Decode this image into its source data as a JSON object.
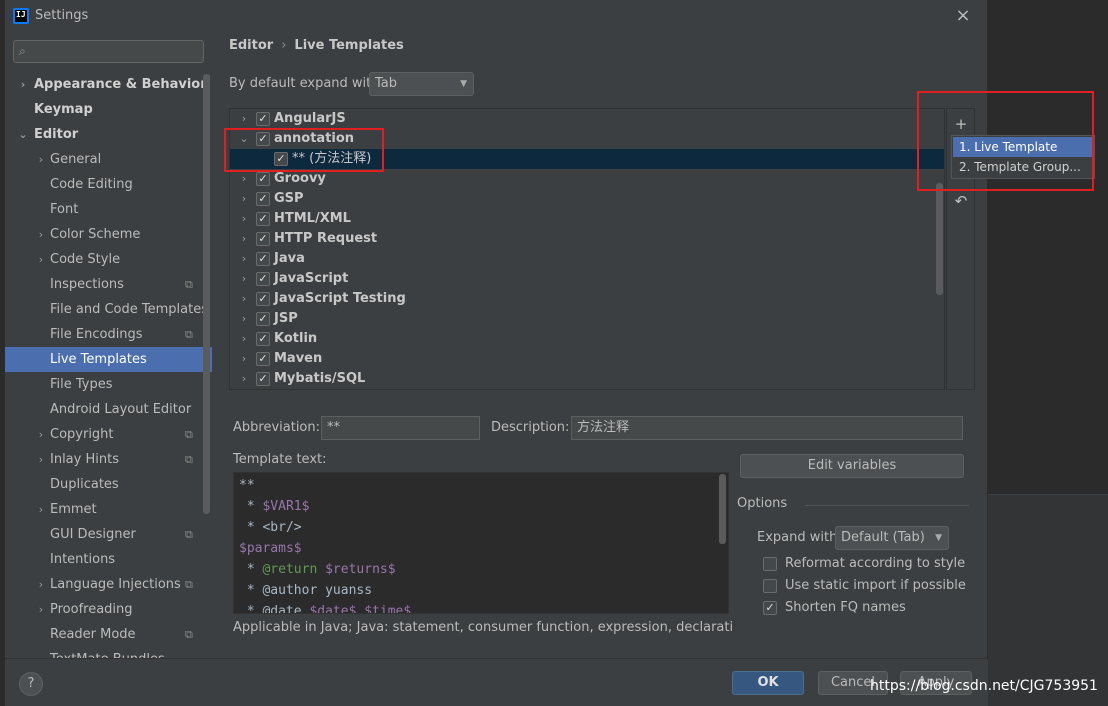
{
  "window": {
    "title": "Settings",
    "close_icon": "×",
    "app_logo_text": "IJ"
  },
  "search": {
    "placeholder": ""
  },
  "sidebar": {
    "items": [
      {
        "label": "Appearance & Behavior",
        "arrow": "›",
        "bold": true
      },
      {
        "label": "Keymap",
        "arrow": "",
        "bold": true
      },
      {
        "label": "Editor",
        "arrow": "⌄",
        "bold": true
      },
      {
        "label": "General",
        "arrow": "›"
      },
      {
        "label": "Code Editing",
        "arrow": ""
      },
      {
        "label": "Font",
        "arrow": ""
      },
      {
        "label": "Color Scheme",
        "arrow": "›"
      },
      {
        "label": "Code Style",
        "arrow": "›"
      },
      {
        "label": "Inspections",
        "arrow": "",
        "copy": true
      },
      {
        "label": "File and Code Templates",
        "arrow": ""
      },
      {
        "label": "File Encodings",
        "arrow": "",
        "copy": true
      },
      {
        "label": "Live Templates",
        "arrow": "",
        "selected": true
      },
      {
        "label": "File Types",
        "arrow": ""
      },
      {
        "label": "Android Layout Editor",
        "arrow": ""
      },
      {
        "label": "Copyright",
        "arrow": "›",
        "copy": true
      },
      {
        "label": "Inlay Hints",
        "arrow": "›",
        "copy": true
      },
      {
        "label": "Duplicates",
        "arrow": ""
      },
      {
        "label": "Emmet",
        "arrow": "›"
      },
      {
        "label": "GUI Designer",
        "arrow": "",
        "copy": true
      },
      {
        "label": "Intentions",
        "arrow": ""
      },
      {
        "label": "Language Injections",
        "arrow": "›",
        "copy": true
      },
      {
        "label": "Proofreading",
        "arrow": "›"
      },
      {
        "label": "Reader Mode",
        "arrow": "",
        "copy": true
      },
      {
        "label": "TextMate Bundles",
        "arrow": ""
      }
    ]
  },
  "breadcrumb": {
    "part1": "Editor",
    "separator": "›",
    "part2": "Live Templates"
  },
  "expand": {
    "label": "By default expand with",
    "value": "Tab"
  },
  "templates": [
    {
      "label": "AngularJS",
      "arrow": "›",
      "checked": true
    },
    {
      "label": "annotation",
      "arrow": "⌄",
      "checked": true
    },
    {
      "label": "** (方法注释)",
      "arrow": "",
      "checked": true,
      "child": true,
      "selected": true
    },
    {
      "label": "Groovy",
      "arrow": "›",
      "checked": true
    },
    {
      "label": "GSP",
      "arrow": "›",
      "checked": true
    },
    {
      "label": "HTML/XML",
      "arrow": "›",
      "checked": true
    },
    {
      "label": "HTTP Request",
      "arrow": "›",
      "checked": true
    },
    {
      "label": "Java",
      "arrow": "›",
      "checked": true
    },
    {
      "label": "JavaScript",
      "arrow": "›",
      "checked": true
    },
    {
      "label": "JavaScript Testing",
      "arrow": "›",
      "checked": true
    },
    {
      "label": "JSP",
      "arrow": "›",
      "checked": true
    },
    {
      "label": "Kotlin",
      "arrow": "›",
      "checked": true
    },
    {
      "label": "Maven",
      "arrow": "›",
      "checked": true
    },
    {
      "label": "Mybatis/SQL",
      "arrow": "›",
      "checked": true
    }
  ],
  "tools": {
    "add": "+",
    "remove": "−",
    "undo": "↶"
  },
  "popup": {
    "item1": "1. Live Template",
    "item2": "2. Template Group..."
  },
  "abbreviation": {
    "label": "Abbreviation:",
    "value": "**"
  },
  "description": {
    "label": "Description:",
    "value": "方法注释"
  },
  "template_text": {
    "label": "Template text:",
    "lines": [
      [
        {
          "t": "**",
          "c": ""
        }
      ],
      [
        {
          "t": " * ",
          "c": ""
        },
        {
          "t": "$VAR1$",
          "c": "var"
        }
      ],
      [
        {
          "t": " * <br/>",
          "c": ""
        }
      ],
      [
        {
          "t": "$params$",
          "c": "var"
        }
      ],
      [
        {
          "t": " * ",
          "c": ""
        },
        {
          "t": "@return",
          "c": "tag"
        },
        {
          "t": " ",
          "c": ""
        },
        {
          "t": "$returns$",
          "c": "var"
        }
      ],
      [
        {
          "t": " * @author yuanss",
          "c": ""
        }
      ],
      [
        {
          "t": " * @date ",
          "c": ""
        },
        {
          "t": "$date$",
          "c": "var"
        },
        {
          "t": " ",
          "c": ""
        },
        {
          "t": "$time$",
          "c": "var"
        }
      ]
    ]
  },
  "edit_variables": "Edit variables",
  "options": {
    "title": "Options",
    "expand_with_label": "Expand with",
    "expand_with_value": "Default (Tab)",
    "reformat": {
      "label": "Reformat according to style",
      "checked": false
    },
    "static_import": {
      "label": "Use static import if possible",
      "checked": false
    },
    "shorten_fq": {
      "label": "Shorten FQ names",
      "checked": true
    }
  },
  "applicable": "Applicable in Java; Java: statement, consumer function, expression, declaration, comment",
  "buttons": {
    "help": "?",
    "ok": "OK",
    "cancel": "Cancel",
    "apply": "Apply"
  },
  "watermark": "https://blog.csdn.net/CJG753951",
  "colors": {
    "selection": "#4b6eaf",
    "primary_button": "#365880",
    "highlight_box": "#e02020"
  }
}
